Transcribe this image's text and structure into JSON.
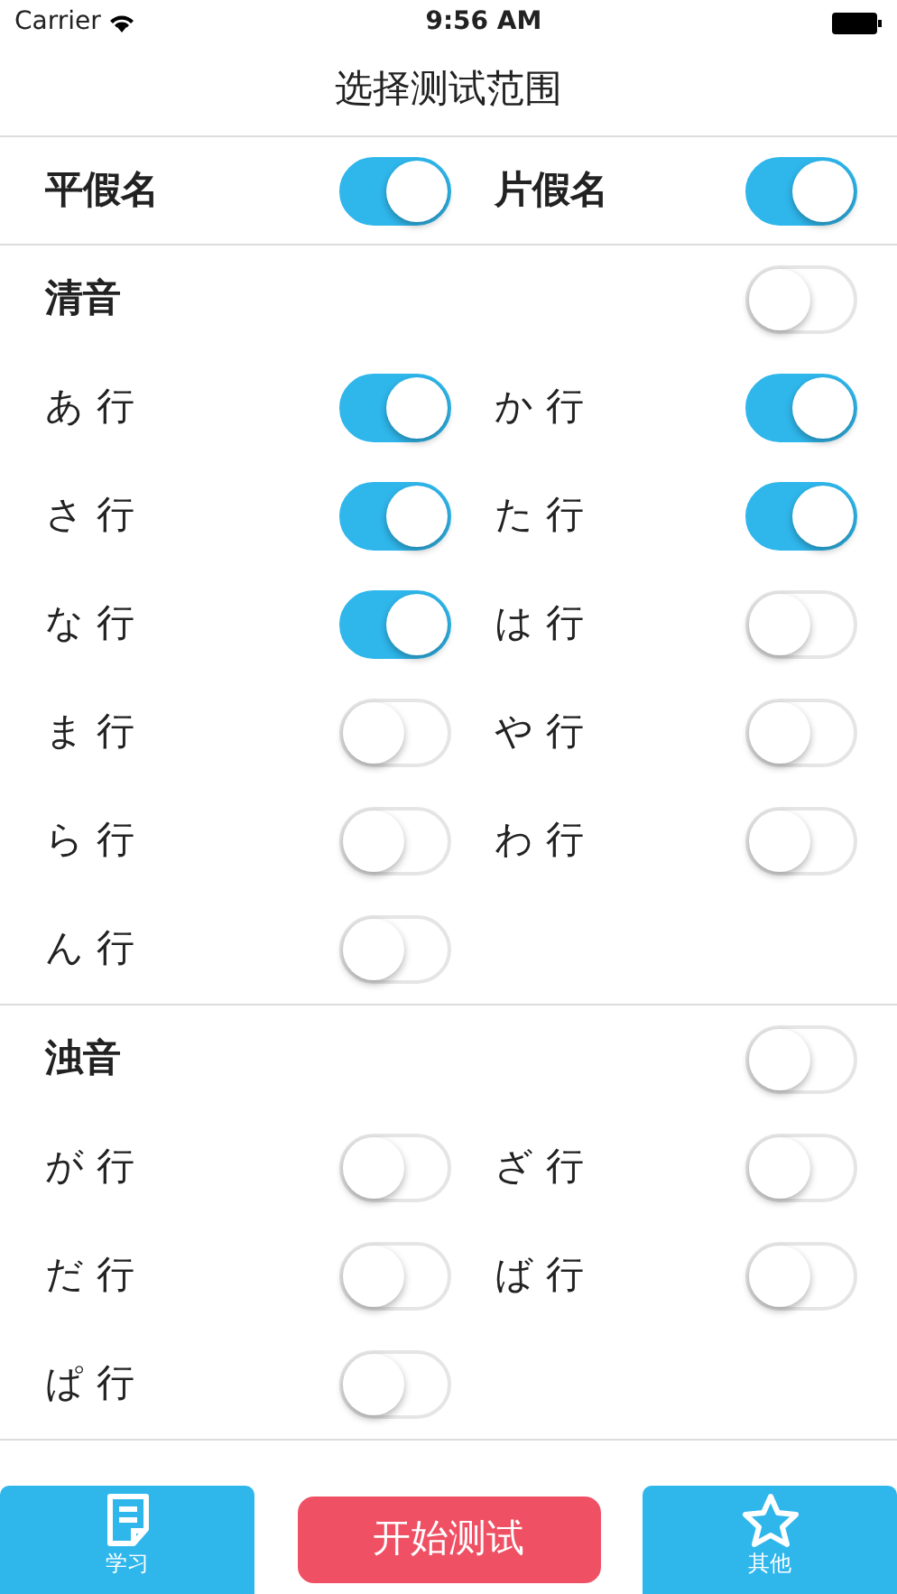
{
  "status_bar": {
    "carrier": "Carrier",
    "time": "9:56 AM"
  },
  "title": "选择测试范围",
  "scripts": [
    {
      "label": "平假名",
      "on": true
    },
    {
      "label": "片假名",
      "on": true
    }
  ],
  "sections": [
    {
      "title": "清音",
      "on": false,
      "rows": [
        [
          {
            "label": "あ 行",
            "on": true
          },
          {
            "label": "か 行",
            "on": true
          }
        ],
        [
          {
            "label": "さ 行",
            "on": true
          },
          {
            "label": "た 行",
            "on": true
          }
        ],
        [
          {
            "label": "な 行",
            "on": true
          },
          {
            "label": "は 行",
            "on": false
          }
        ],
        [
          {
            "label": "ま 行",
            "on": false
          },
          {
            "label": "や 行",
            "on": false
          }
        ],
        [
          {
            "label": "ら 行",
            "on": false
          },
          {
            "label": "わ 行",
            "on": false
          }
        ],
        [
          {
            "label": "ん 行",
            "on": false
          }
        ]
      ]
    },
    {
      "title": "浊音",
      "on": false,
      "rows": [
        [
          {
            "label": "が 行",
            "on": false
          },
          {
            "label": "ざ 行",
            "on": false
          }
        ],
        [
          {
            "label": "だ 行",
            "on": false
          },
          {
            "label": "ば 行",
            "on": false
          }
        ],
        [
          {
            "label": "ぱ 行",
            "on": false
          }
        ]
      ]
    }
  ],
  "bottom_bar": {
    "left": {
      "label": "学习"
    },
    "start": "开始测试",
    "right": {
      "label": "其他"
    }
  }
}
